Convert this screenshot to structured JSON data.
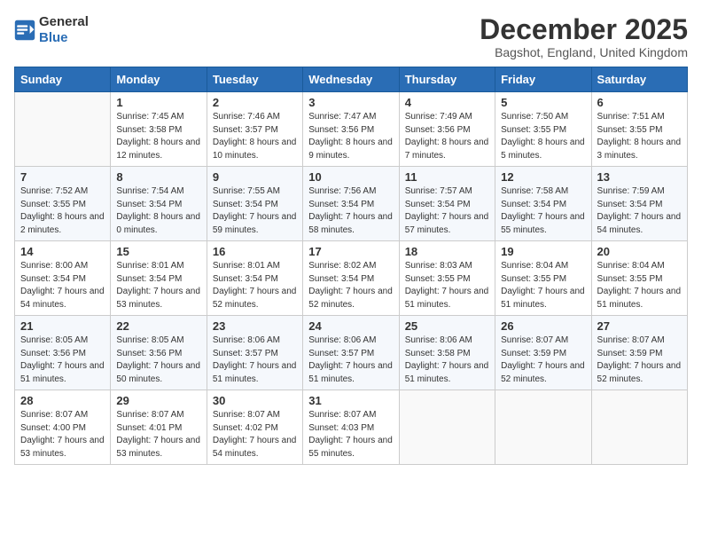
{
  "logo": {
    "general": "General",
    "blue": "Blue"
  },
  "header": {
    "month": "December 2025",
    "location": "Bagshot, England, United Kingdom"
  },
  "weekdays": [
    "Sunday",
    "Monday",
    "Tuesday",
    "Wednesday",
    "Thursday",
    "Friday",
    "Saturday"
  ],
  "weeks": [
    [
      {
        "day": "",
        "sunrise": "",
        "sunset": "",
        "daylight": ""
      },
      {
        "day": "1",
        "sunrise": "Sunrise: 7:45 AM",
        "sunset": "Sunset: 3:58 PM",
        "daylight": "Daylight: 8 hours and 12 minutes."
      },
      {
        "day": "2",
        "sunrise": "Sunrise: 7:46 AM",
        "sunset": "Sunset: 3:57 PM",
        "daylight": "Daylight: 8 hours and 10 minutes."
      },
      {
        "day": "3",
        "sunrise": "Sunrise: 7:47 AM",
        "sunset": "Sunset: 3:56 PM",
        "daylight": "Daylight: 8 hours and 9 minutes."
      },
      {
        "day": "4",
        "sunrise": "Sunrise: 7:49 AM",
        "sunset": "Sunset: 3:56 PM",
        "daylight": "Daylight: 8 hours and 7 minutes."
      },
      {
        "day": "5",
        "sunrise": "Sunrise: 7:50 AM",
        "sunset": "Sunset: 3:55 PM",
        "daylight": "Daylight: 8 hours and 5 minutes."
      },
      {
        "day": "6",
        "sunrise": "Sunrise: 7:51 AM",
        "sunset": "Sunset: 3:55 PM",
        "daylight": "Daylight: 8 hours and 3 minutes."
      }
    ],
    [
      {
        "day": "7",
        "sunrise": "Sunrise: 7:52 AM",
        "sunset": "Sunset: 3:55 PM",
        "daylight": "Daylight: 8 hours and 2 minutes."
      },
      {
        "day": "8",
        "sunrise": "Sunrise: 7:54 AM",
        "sunset": "Sunset: 3:54 PM",
        "daylight": "Daylight: 8 hours and 0 minutes."
      },
      {
        "day": "9",
        "sunrise": "Sunrise: 7:55 AM",
        "sunset": "Sunset: 3:54 PM",
        "daylight": "Daylight: 7 hours and 59 minutes."
      },
      {
        "day": "10",
        "sunrise": "Sunrise: 7:56 AM",
        "sunset": "Sunset: 3:54 PM",
        "daylight": "Daylight: 7 hours and 58 minutes."
      },
      {
        "day": "11",
        "sunrise": "Sunrise: 7:57 AM",
        "sunset": "Sunset: 3:54 PM",
        "daylight": "Daylight: 7 hours and 57 minutes."
      },
      {
        "day": "12",
        "sunrise": "Sunrise: 7:58 AM",
        "sunset": "Sunset: 3:54 PM",
        "daylight": "Daylight: 7 hours and 55 minutes."
      },
      {
        "day": "13",
        "sunrise": "Sunrise: 7:59 AM",
        "sunset": "Sunset: 3:54 PM",
        "daylight": "Daylight: 7 hours and 54 minutes."
      }
    ],
    [
      {
        "day": "14",
        "sunrise": "Sunrise: 8:00 AM",
        "sunset": "Sunset: 3:54 PM",
        "daylight": "Daylight: 7 hours and 54 minutes."
      },
      {
        "day": "15",
        "sunrise": "Sunrise: 8:01 AM",
        "sunset": "Sunset: 3:54 PM",
        "daylight": "Daylight: 7 hours and 53 minutes."
      },
      {
        "day": "16",
        "sunrise": "Sunrise: 8:01 AM",
        "sunset": "Sunset: 3:54 PM",
        "daylight": "Daylight: 7 hours and 52 minutes."
      },
      {
        "day": "17",
        "sunrise": "Sunrise: 8:02 AM",
        "sunset": "Sunset: 3:54 PM",
        "daylight": "Daylight: 7 hours and 52 minutes."
      },
      {
        "day": "18",
        "sunrise": "Sunrise: 8:03 AM",
        "sunset": "Sunset: 3:55 PM",
        "daylight": "Daylight: 7 hours and 51 minutes."
      },
      {
        "day": "19",
        "sunrise": "Sunrise: 8:04 AM",
        "sunset": "Sunset: 3:55 PM",
        "daylight": "Daylight: 7 hours and 51 minutes."
      },
      {
        "day": "20",
        "sunrise": "Sunrise: 8:04 AM",
        "sunset": "Sunset: 3:55 PM",
        "daylight": "Daylight: 7 hours and 51 minutes."
      }
    ],
    [
      {
        "day": "21",
        "sunrise": "Sunrise: 8:05 AM",
        "sunset": "Sunset: 3:56 PM",
        "daylight": "Daylight: 7 hours and 51 minutes."
      },
      {
        "day": "22",
        "sunrise": "Sunrise: 8:05 AM",
        "sunset": "Sunset: 3:56 PM",
        "daylight": "Daylight: 7 hours and 50 minutes."
      },
      {
        "day": "23",
        "sunrise": "Sunrise: 8:06 AM",
        "sunset": "Sunset: 3:57 PM",
        "daylight": "Daylight: 7 hours and 51 minutes."
      },
      {
        "day": "24",
        "sunrise": "Sunrise: 8:06 AM",
        "sunset": "Sunset: 3:57 PM",
        "daylight": "Daylight: 7 hours and 51 minutes."
      },
      {
        "day": "25",
        "sunrise": "Sunrise: 8:06 AM",
        "sunset": "Sunset: 3:58 PM",
        "daylight": "Daylight: 7 hours and 51 minutes."
      },
      {
        "day": "26",
        "sunrise": "Sunrise: 8:07 AM",
        "sunset": "Sunset: 3:59 PM",
        "daylight": "Daylight: 7 hours and 52 minutes."
      },
      {
        "day": "27",
        "sunrise": "Sunrise: 8:07 AM",
        "sunset": "Sunset: 3:59 PM",
        "daylight": "Daylight: 7 hours and 52 minutes."
      }
    ],
    [
      {
        "day": "28",
        "sunrise": "Sunrise: 8:07 AM",
        "sunset": "Sunset: 4:00 PM",
        "daylight": "Daylight: 7 hours and 53 minutes."
      },
      {
        "day": "29",
        "sunrise": "Sunrise: 8:07 AM",
        "sunset": "Sunset: 4:01 PM",
        "daylight": "Daylight: 7 hours and 53 minutes."
      },
      {
        "day": "30",
        "sunrise": "Sunrise: 8:07 AM",
        "sunset": "Sunset: 4:02 PM",
        "daylight": "Daylight: 7 hours and 54 minutes."
      },
      {
        "day": "31",
        "sunrise": "Sunrise: 8:07 AM",
        "sunset": "Sunset: 4:03 PM",
        "daylight": "Daylight: 7 hours and 55 minutes."
      },
      {
        "day": "",
        "sunrise": "",
        "sunset": "",
        "daylight": ""
      },
      {
        "day": "",
        "sunrise": "",
        "sunset": "",
        "daylight": ""
      },
      {
        "day": "",
        "sunrise": "",
        "sunset": "",
        "daylight": ""
      }
    ]
  ]
}
